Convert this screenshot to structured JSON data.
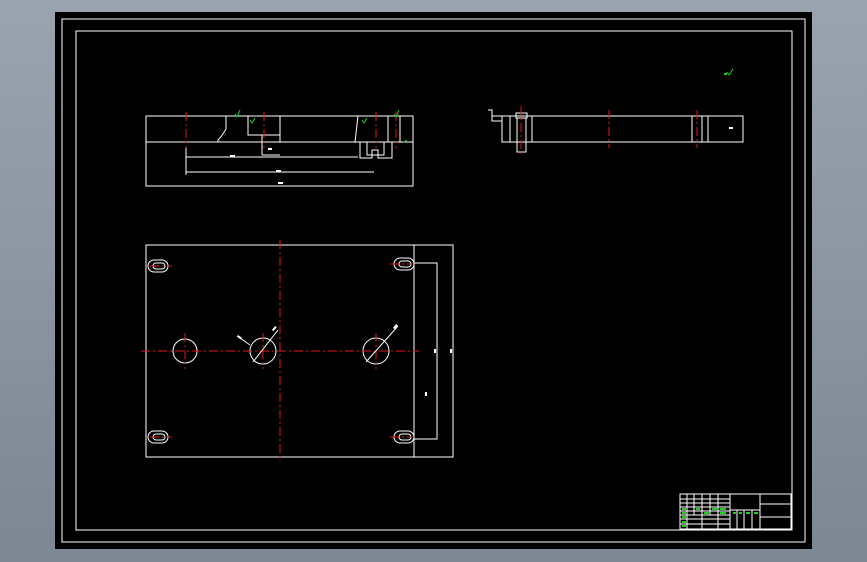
{
  "colors": {
    "background": "#8e97a2",
    "sheet": "#000000",
    "line": "#ffffff",
    "centerline": "#e01818",
    "roughness_mark": "#18d018"
  },
  "icons": {
    "roughness_symbols": [
      "roughness-mark-icon"
    ]
  }
}
